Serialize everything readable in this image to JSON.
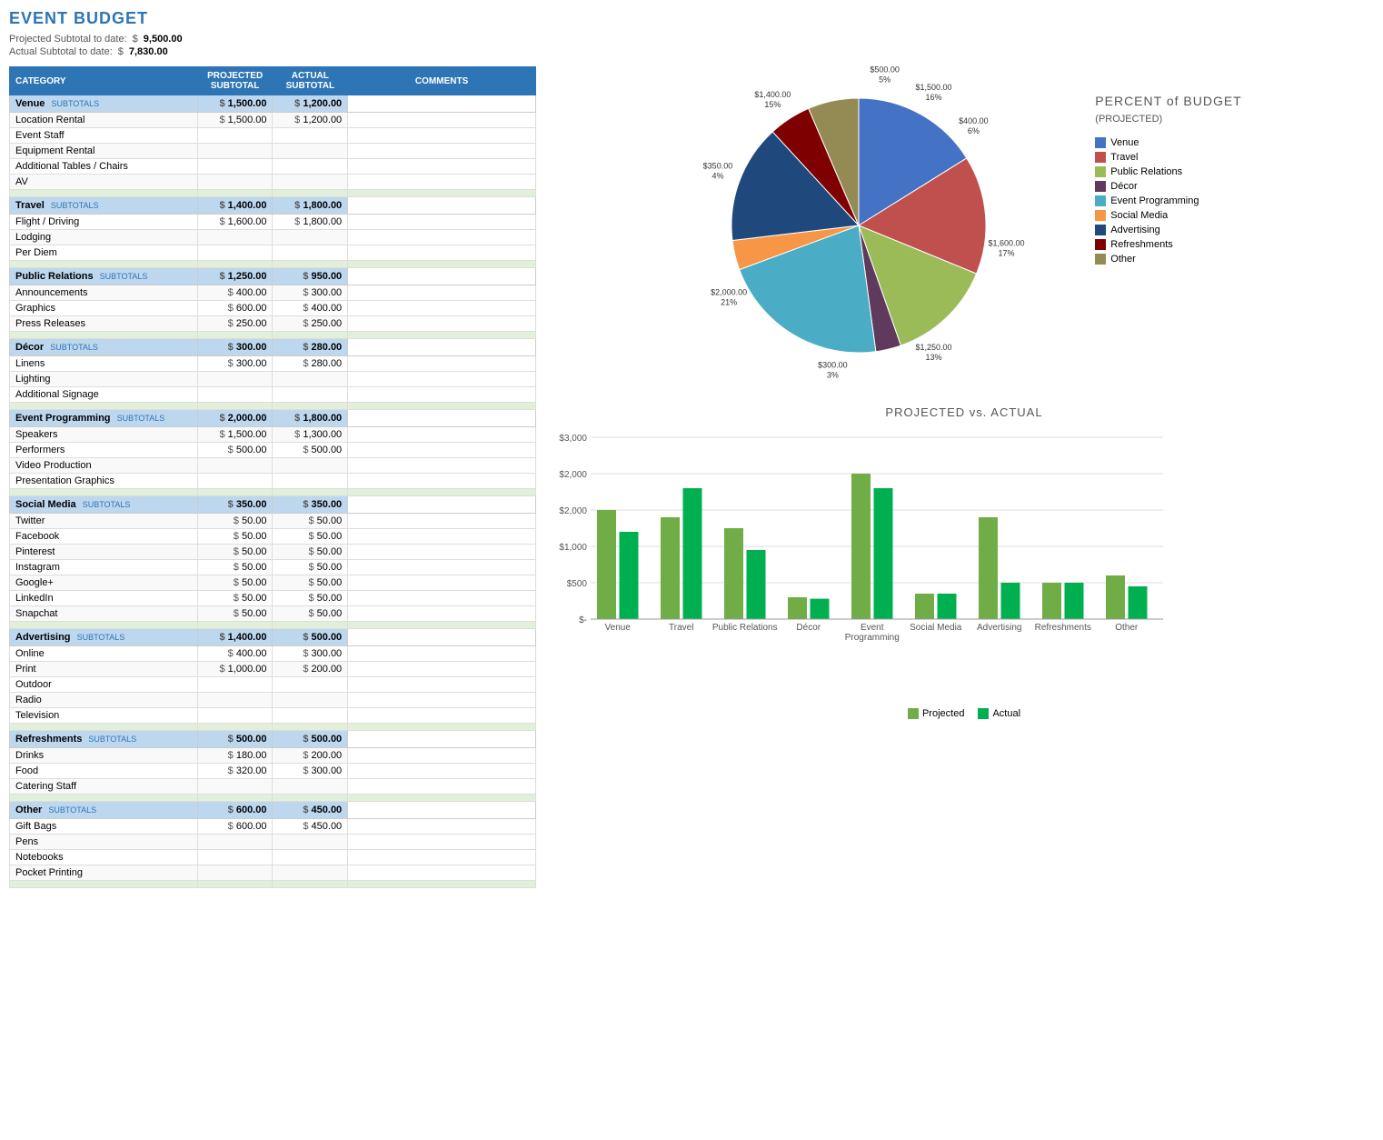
{
  "title": "EVENT BUDGET",
  "summary": {
    "projected_label": "Projected Subtotal to date:",
    "projected_dollar": "$",
    "projected_value": "9,500.00",
    "actual_label": "Actual Subtotal to date:",
    "actual_dollar": "$",
    "actual_value": "7,830.00"
  },
  "table": {
    "headers": [
      "CATEGORY",
      "PROJECTED SUBTOTAL",
      "ACTUAL SUBTOTAL",
      "COMMENTS"
    ],
    "sections": [
      {
        "name": "Venue",
        "projected": "1,500.00",
        "actual": "1,200.00",
        "items": [
          {
            "name": "Location Rental",
            "proj": "1,500.00",
            "act": "1,200.00"
          },
          {
            "name": "Event Staff",
            "proj": "",
            "act": ""
          },
          {
            "name": "Equipment Rental",
            "proj": "",
            "act": ""
          },
          {
            "name": "Additional Tables / Chairs",
            "proj": "",
            "act": ""
          },
          {
            "name": "AV",
            "proj": "",
            "act": ""
          }
        ]
      },
      {
        "name": "Travel",
        "projected": "1,400.00",
        "actual": "1,800.00",
        "items": [
          {
            "name": "Flight / Driving",
            "proj": "1,600.00",
            "act": "1,800.00"
          },
          {
            "name": "Lodging",
            "proj": "",
            "act": ""
          },
          {
            "name": "Per Diem",
            "proj": "",
            "act": ""
          }
        ]
      },
      {
        "name": "Public Relations",
        "projected": "1,250.00",
        "actual": "950.00",
        "items": [
          {
            "name": "Announcements",
            "proj": "400.00",
            "act": "300.00"
          },
          {
            "name": "Graphics",
            "proj": "600.00",
            "act": "400.00"
          },
          {
            "name": "Press Releases",
            "proj": "250.00",
            "act": "250.00"
          }
        ]
      },
      {
        "name": "Décor",
        "projected": "300.00",
        "actual": "280.00",
        "items": [
          {
            "name": "Linens",
            "proj": "300.00",
            "act": "280.00"
          },
          {
            "name": "Lighting",
            "proj": "",
            "act": ""
          },
          {
            "name": "Additional Signage",
            "proj": "",
            "act": ""
          }
        ]
      },
      {
        "name": "Event Programming",
        "projected": "2,000.00",
        "actual": "1,800.00",
        "items": [
          {
            "name": "Speakers",
            "proj": "1,500.00",
            "act": "1,300.00"
          },
          {
            "name": "Performers",
            "proj": "500.00",
            "act": "500.00"
          },
          {
            "name": "Video Production",
            "proj": "",
            "act": ""
          },
          {
            "name": "Presentation Graphics",
            "proj": "",
            "act": ""
          }
        ]
      },
      {
        "name": "Social Media",
        "projected": "350.00",
        "actual": "350.00",
        "items": [
          {
            "name": "Twitter",
            "proj": "50.00",
            "act": "50.00"
          },
          {
            "name": "Facebook",
            "proj": "50.00",
            "act": "50.00"
          },
          {
            "name": "Pinterest",
            "proj": "50.00",
            "act": "50.00"
          },
          {
            "name": "Instagram",
            "proj": "50.00",
            "act": "50.00"
          },
          {
            "name": "Google+",
            "proj": "50.00",
            "act": "50.00"
          },
          {
            "name": "LinkedIn",
            "proj": "50.00",
            "act": "50.00"
          },
          {
            "name": "Snapchat",
            "proj": "50.00",
            "act": "50.00"
          }
        ]
      },
      {
        "name": "Advertising",
        "projected": "1,400.00",
        "actual": "500.00",
        "items": [
          {
            "name": "Online",
            "proj": "400.00",
            "act": "300.00"
          },
          {
            "name": "Print",
            "proj": "1,000.00",
            "act": "200.00"
          },
          {
            "name": "Outdoor",
            "proj": "",
            "act": ""
          },
          {
            "name": "Radio",
            "proj": "",
            "act": ""
          },
          {
            "name": "Television",
            "proj": "",
            "act": ""
          }
        ]
      },
      {
        "name": "Refreshments",
        "projected": "500.00",
        "actual": "500.00",
        "items": [
          {
            "name": "Drinks",
            "proj": "180.00",
            "act": "200.00"
          },
          {
            "name": "Food",
            "proj": "320.00",
            "act": "300.00"
          },
          {
            "name": "Catering Staff",
            "proj": "",
            "act": ""
          }
        ]
      },
      {
        "name": "Other",
        "projected": "600.00",
        "actual": "450.00",
        "items": [
          {
            "name": "Gift Bags",
            "proj": "600.00",
            "act": "450.00"
          },
          {
            "name": "Pens",
            "proj": "",
            "act": ""
          },
          {
            "name": "Notebooks",
            "proj": "",
            "act": ""
          },
          {
            "name": "Pocket Printing",
            "proj": "",
            "act": ""
          }
        ]
      }
    ]
  },
  "pie_chart": {
    "title": "PERCENT of BUDGET",
    "subtitle": "(PROJECTED)",
    "segments": [
      {
        "label": "Venue",
        "value": 1500,
        "percent": "16%",
        "color": "#4472c4",
        "label_pos": "$1,500.00\n16%"
      },
      {
        "label": "Travel",
        "color": "#c0504d"
      },
      {
        "label": "Public Relations",
        "color": "#9bbb59"
      },
      {
        "label": "Décor",
        "color": "#603a5d"
      },
      {
        "label": "Event Programming",
        "color": "#4bacc6"
      },
      {
        "label": "Social Media",
        "color": "#f79646"
      },
      {
        "label": "Advertising",
        "color": "#1f497d"
      },
      {
        "label": "Refreshments",
        "color": "#7f0000"
      },
      {
        "label": "Other",
        "color": "#948a54"
      }
    ],
    "callouts": [
      {
        "label": "$1,500.00\n16%",
        "side": "top-right"
      },
      {
        "label": "$1,600.00\n17%",
        "side": "right"
      },
      {
        "label": "$1,250.00\n13%",
        "side": "bottom-right"
      },
      {
        "label": "$300.00\n3%",
        "side": "bottom"
      },
      {
        "label": "$2,000.00\n21%",
        "side": "bottom-left"
      },
      {
        "label": "$350.00\n4%",
        "side": "left"
      },
      {
        "label": "$1,400.00\n15%",
        "side": "top-left"
      },
      {
        "label": "$500.00\n5%",
        "side": "top-left2"
      },
      {
        "label": "$400.00\n6%",
        "side": "top"
      }
    ]
  },
  "bar_chart": {
    "title": "PROJECTED vs. ACTUAL",
    "categories": [
      "Venue",
      "Travel",
      "Public Relations",
      "Décor",
      "Event\nProgramming",
      "Social Media",
      "Advertising",
      "Refreshments",
      "Other"
    ],
    "projected": [
      1500,
      1400,
      1250,
      300,
      2000,
      350,
      1400,
      500,
      600
    ],
    "actual": [
      1200,
      1800,
      950,
      280,
      1800,
      350,
      500,
      500,
      450
    ],
    "max": 2500,
    "color_projected": "#70ad47",
    "color_actual": "#00b050",
    "legend_projected": "Projected",
    "legend_actual": "Actual"
  }
}
